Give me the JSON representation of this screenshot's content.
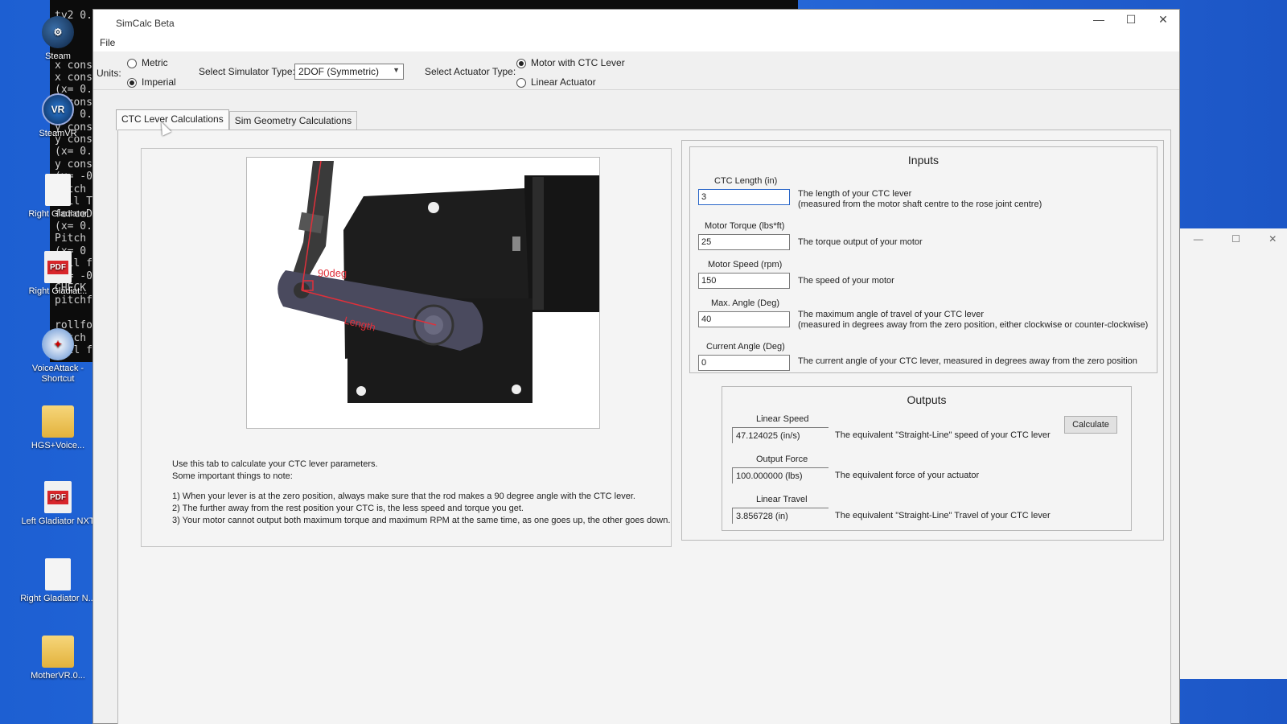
{
  "desktop": {
    "icons": [
      {
        "label": "Steam",
        "icon": "steam-icon"
      },
      {
        "label": "SteamVR",
        "icon": "steamvr-icon"
      },
      {
        "label": "Right Gladiator",
        "icon": "document-icon"
      },
      {
        "label": "Right Gladiat...",
        "icon": "pdf-icon"
      },
      {
        "label": "VoiceAttack - Shortcut",
        "icon": "voiceattack-icon"
      },
      {
        "label": "HGS+Voice...",
        "icon": "folder-icon"
      },
      {
        "label": "Left Gladiator NXT",
        "icon": "pdf-icon"
      },
      {
        "label": "Right Gladiator N...",
        "icon": "document-icon"
      },
      {
        "label": "MotherVR.0...",
        "icon": "folder-icon"
      }
    ],
    "terminal_lines": [
      "x cons",
      "x cons",
      "(x= 0.",
      "x cons",
      "(x= 0.",
      "y cons",
      "y cons",
      "(x= 0.",
      "y cons",
      "(x= -0",
      "Pitch",
      "Roll T",
      "forceD",
      "(x= 0.",
      "Pitch",
      "(x= 0",
      "Roll f",
      "(x= -0",
      "CHECK",
      "pitchf",
      "",
      "rollfo",
      "Pitch",
      "Roll f"
    ],
    "terminal_header": "ty2 0."
  },
  "window": {
    "title": "SimCalc Beta",
    "minimize": "—",
    "maximize": "☐",
    "close": "✕"
  },
  "menu": {
    "file": "File"
  },
  "toolbar": {
    "units_label": "Units:",
    "metric": "Metric",
    "imperial": "Imperial",
    "units_selected": "Imperial",
    "sim_type_label": "Select Simulator Type:",
    "sim_type_value": "2DOF (Symmetric)",
    "actuator_label": "Select Actuator Type:",
    "actuator_motor": "Motor with CTC Lever",
    "actuator_linear": "Linear Actuator",
    "actuator_selected": "Motor with CTC Lever"
  },
  "tabs": [
    {
      "label": "CTC Lever Calculations",
      "active": true
    },
    {
      "label": "Sim Geometry Calculations",
      "active": false
    }
  ],
  "diagram": {
    "angle_label": "90deg",
    "length_label": "Length",
    "accent_color": "#e0303a"
  },
  "notes": {
    "intro": "Use this tab to calculate your CTC lever parameters.",
    "subtitle": "Some important things to note:",
    "item1": "1) When your lever is at the zero position, always make sure that the rod makes a 90 degree angle with the CTC lever.",
    "item2": "2) The further away from the rest position your CTC is, the less speed and torque you get.",
    "item3": "3) Your motor cannot output both maximum torque and maximum RPM at the same time, as one goes up, the other goes down."
  },
  "inputs": {
    "title": "Inputs",
    "ctc_length": {
      "label": "CTC Length (in)",
      "value": "3",
      "desc1": "The length of your CTC lever",
      "desc2": "(measured from the motor shaft centre to the rose joint centre)"
    },
    "motor_torque": {
      "label": "Motor Torque (lbs*ft)",
      "value": "25",
      "desc1": "The torque output of your motor"
    },
    "motor_speed": {
      "label": "Motor Speed (rpm)",
      "value": "150",
      "desc1": "The speed of your motor"
    },
    "max_angle": {
      "label": "Max. Angle (Deg)",
      "value": "40",
      "desc1": "The maximum angle of travel of your CTC lever",
      "desc2": "(measured in degrees away from the zero position, either clockwise or counter-clockwise)"
    },
    "current_angle": {
      "label": "Current Angle (Deg)",
      "value": "0",
      "desc1": "The current angle of your CTC lever, measured in degrees away from the zero position"
    }
  },
  "outputs": {
    "title": "Outputs",
    "calculate": "Calculate",
    "linear_speed": {
      "label": "Linear Speed",
      "value": "47.124025   (in/s)",
      "desc": "The equivalent \"Straight-Line\" speed of your CTC lever"
    },
    "output_force": {
      "label": "Output Force",
      "value": "100.000000   (lbs)",
      "desc": "The equivalent force of your actuator"
    },
    "linear_travel": {
      "label": "Linear Travel",
      "value": "3.856728   (in)",
      "desc": "The equivalent \"Straight-Line\" Travel of your CTC lever"
    }
  }
}
